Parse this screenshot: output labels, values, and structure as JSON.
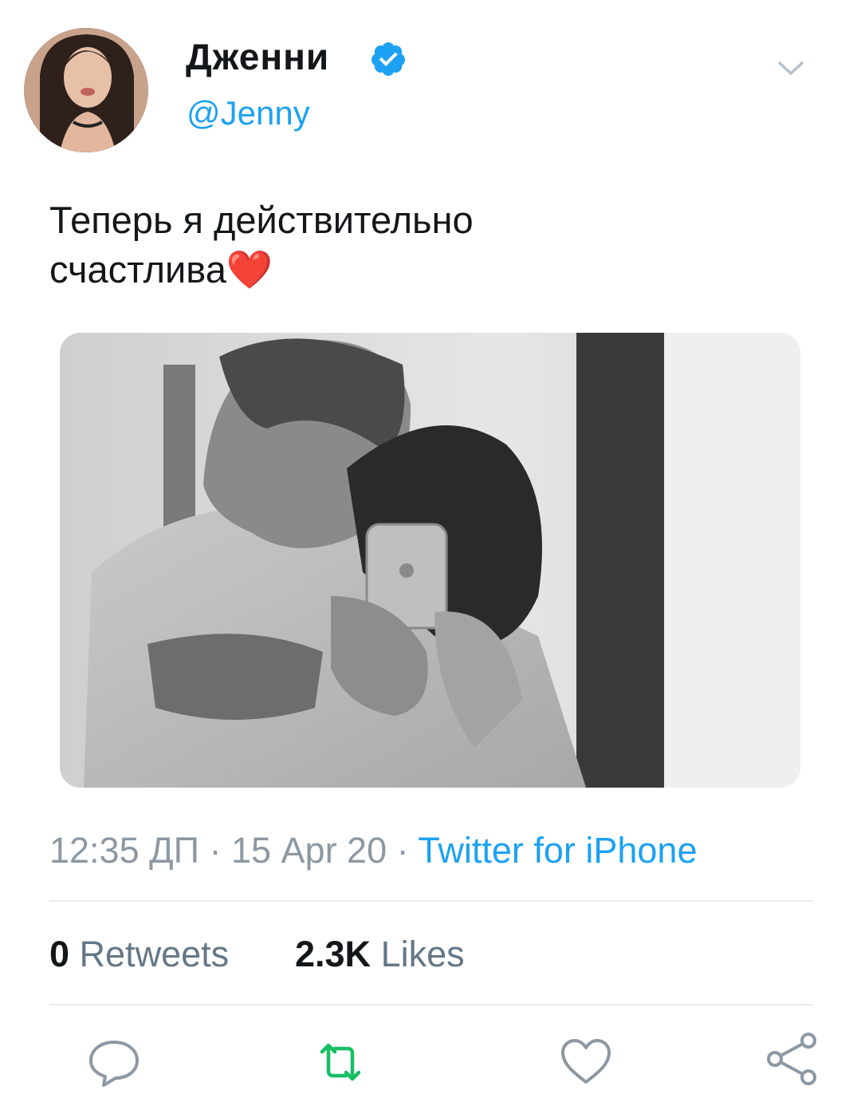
{
  "tweet": {
    "author": {
      "display_name": "Дженни",
      "handle": "@Jenny",
      "verified": true
    },
    "text_lines": [
      "Теперь я действительно",
      "счастлива❤️"
    ],
    "timestamp": "12:35 ДП",
    "date": "15 Apr 20",
    "separator": "·",
    "source": "Twitter for iPhone",
    "stats": {
      "retweets_count": "0",
      "retweets_label": "Retweets",
      "likes_count": "2.3K",
      "likes_label": "Likes"
    }
  },
  "icons": {
    "verified": "verified-badge-icon",
    "menu": "chevron-down-icon",
    "reply": "reply-icon",
    "retweet": "retweet-icon",
    "like": "heart-icon",
    "share": "share-icon"
  },
  "colors": {
    "accent": "#1da1f2",
    "retweet": "#17bf63",
    "muted": "#8c98a3",
    "text": "#14171a",
    "divider": "#e6ecf0"
  }
}
